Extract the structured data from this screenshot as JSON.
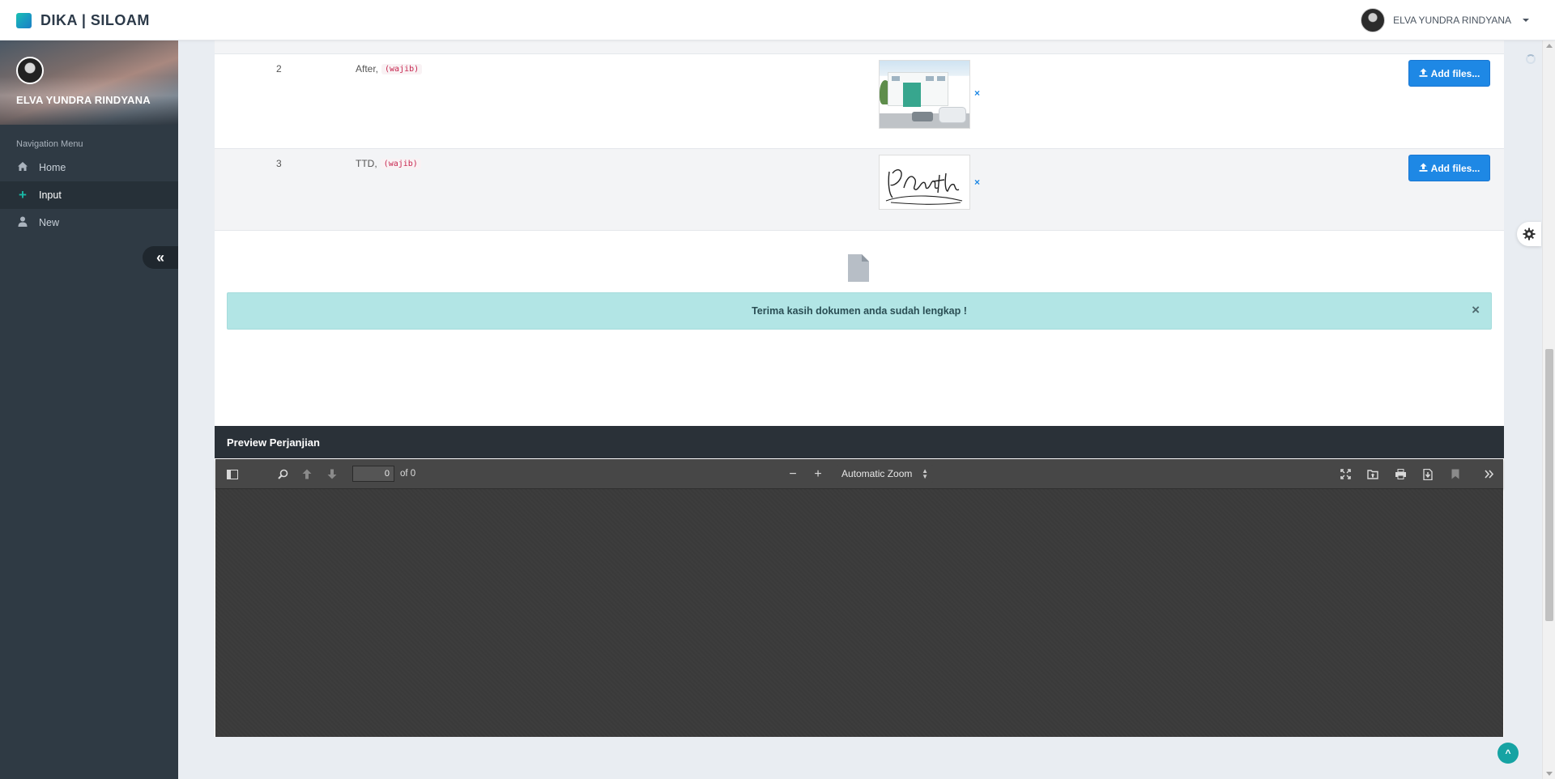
{
  "app": {
    "brand": "DIKA | SILOAM"
  },
  "topbar": {
    "user_name": "ELVA YUNDRA RINDYANA"
  },
  "sidebar": {
    "profile_name": "ELVA YUNDRA RINDYANA",
    "caption": "Navigation Menu",
    "items": [
      {
        "label": "Home",
        "icon": "home-icon"
      },
      {
        "label": "Input",
        "icon": "plus-icon",
        "active": true
      },
      {
        "label": "New",
        "icon": "user-icon"
      }
    ]
  },
  "documents": {
    "rows": [
      {
        "no": "2",
        "label": "After,",
        "tag": "(wajib)",
        "button": "Add files..."
      },
      {
        "no": "3",
        "label": "TTD,",
        "tag": "(wajib)",
        "button": "Add files..."
      }
    ],
    "remove_symbol": "×"
  },
  "alert": {
    "message": "Terima kasih dokumen anda sudah lengkap !",
    "close": "×"
  },
  "preview": {
    "title": "Preview Perjanjian",
    "page_value": "0",
    "page_total": "of 0",
    "zoom": "Automatic Zoom"
  },
  "colors": {
    "accent": "#1e88e5",
    "teal": "#19b9a6",
    "alert_bg": "#b2e5e5",
    "sidebar_bg": "#2f3a44"
  }
}
